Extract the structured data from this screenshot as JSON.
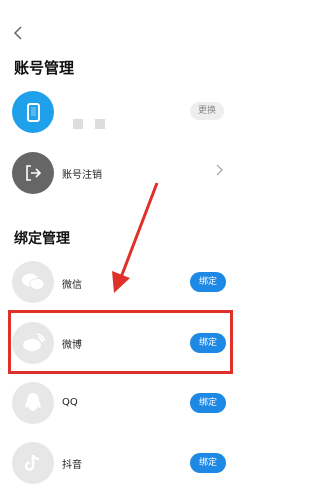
{
  "header": {
    "back_icon": "chevron-left-icon",
    "title": "账号管理"
  },
  "account": {
    "phone_icon": "phone-icon",
    "change_label": "更换"
  },
  "logout": {
    "label": "账号注销",
    "icon": "logout-icon",
    "chevron": "chevron-right-icon"
  },
  "binding": {
    "title": "绑定管理",
    "items": [
      {
        "name": "微信",
        "icon": "wechat-icon",
        "button": "绑定"
      },
      {
        "name": "微博",
        "icon": "weibo-icon",
        "button": "绑定"
      },
      {
        "name": "QQ",
        "icon": "qq-icon",
        "button": "绑定"
      },
      {
        "name": "抖音",
        "icon": "tiktok-icon",
        "button": "绑定"
      }
    ]
  },
  "colors": {
    "accent": "#1e88e5",
    "phone_circle": "#1ea0ea",
    "annotation": "#e0302a"
  }
}
